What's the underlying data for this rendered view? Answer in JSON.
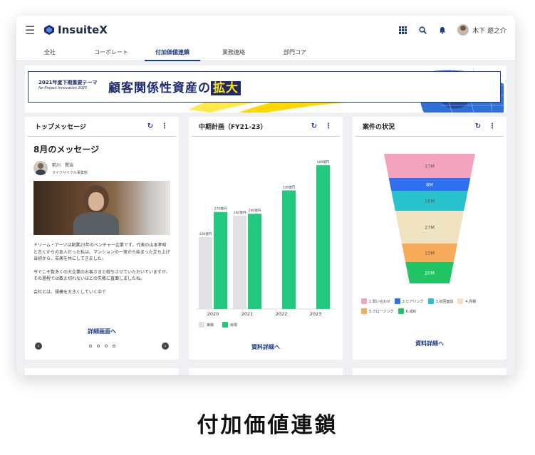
{
  "app": {
    "name": "InsuiteX"
  },
  "header": {
    "user_name": "木下 遊之介"
  },
  "tabs": [
    {
      "label": "全社"
    },
    {
      "label": "コーポレート"
    },
    {
      "label": "付加価値連鎖",
      "active": true
    },
    {
      "label": "業務連絡"
    },
    {
      "label": "部門コア"
    }
  ],
  "banner": {
    "small": "2021年度下期重要テーマ",
    "sub": "for Project Innovation 2025",
    "main": "顧客関係性資産の",
    "highlight": "拡大"
  },
  "top_message": {
    "card_title": "トップメッセージ",
    "title": "8月のメッセージ",
    "author_name": "前川　賢治",
    "author_dept": "ライフサイクル事業部",
    "paragraphs": [
      "ドリーム・アーツは創業23年のベンチャー企業です。代表の山本孝昭と古くからの友人だった私は、マンションの一室から始まった立ち上げ当初から、苦楽を共にしてきました。",
      "今でこそ数多くの大企業のお客さまと取引させていただいていますが、その過程では数え切れないほどの失敗に直面しましたね。",
      "会社とは、規模を大きくしていく中で"
    ],
    "link": "詳細画面へ",
    "page_count": 4
  },
  "plan": {
    "card_title": "中期計画（FY21-23）",
    "link": "資料詳細へ",
    "legend": [
      "実績",
      "目標"
    ]
  },
  "pipeline": {
    "card_title": "案件の状況",
    "link": "資料詳細へ"
  },
  "chart_data": [
    {
      "type": "bar",
      "title": "中期計画（FY21-23）",
      "categories": [
        "2020",
        "2021",
        "2022",
        "2023"
      ],
      "series": [
        {
          "name": "実績",
          "values": [
            200,
            260,
            null,
            null
          ],
          "labels": [
            "200億円",
            "260億円",
            "",
            ""
          ],
          "color": "#dfe1e5"
        },
        {
          "name": "目標",
          "values": [
            270,
            265,
            330,
            400
          ],
          "labels": [
            "270億円",
            "260億円",
            "330億円",
            "400億円"
          ],
          "color": "#22c97e"
        }
      ],
      "ylim": [
        0,
        420
      ]
    },
    {
      "type": "funnel",
      "title": "案件の状況",
      "categories": [
        "1.問い合わせ",
        "2.ヒアリング",
        "3.初回面談",
        "4.見積",
        "5.クロージング",
        "6.成約"
      ],
      "values": [
        17,
        8,
        16,
        27,
        13,
        20
      ],
      "labels": [
        "17M",
        "8M",
        "16M",
        "27M",
        "13M",
        "20M"
      ],
      "colors": [
        "#f4a3bf",
        "#2f6ff0",
        "#27c2cc",
        "#efe3c2",
        "#f8ab5a",
        "#20c464"
      ]
    }
  ],
  "caption": "付加価値連鎖"
}
